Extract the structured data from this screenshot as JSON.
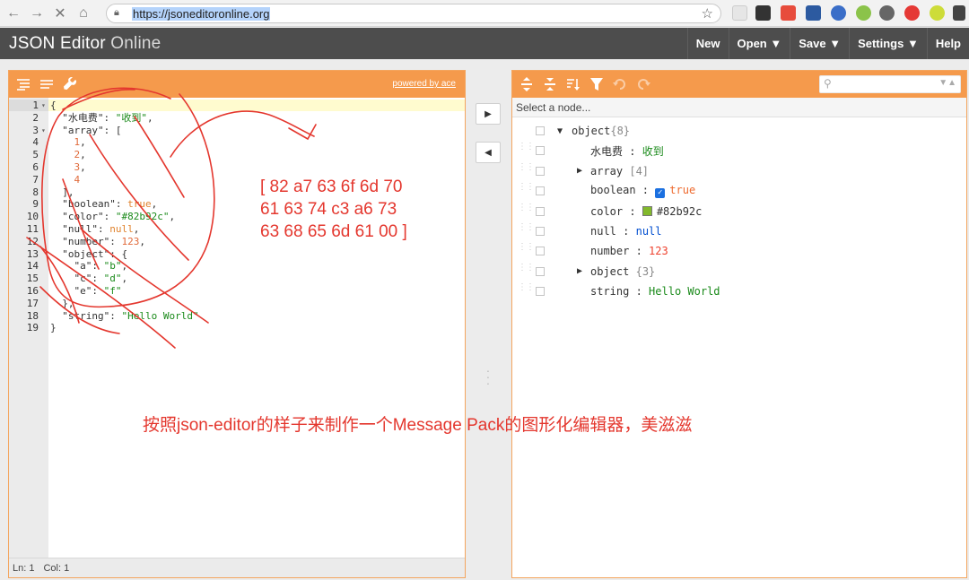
{
  "browser": {
    "url": "https://jsoneditoronline.org"
  },
  "app": {
    "title_bold": "JSON Editor",
    "title_light": "Online",
    "menus": [
      "New",
      "Open ▼",
      "Save ▼",
      "Settings ▼",
      "Help"
    ]
  },
  "code_editor": {
    "powered_by": "powered by ace",
    "lines": [
      {
        "n": "1",
        "fold": "▾",
        "parts": [
          [
            "k",
            "{"
          ]
        ]
      },
      {
        "n": "2",
        "fold": "",
        "parts": [
          [
            "k",
            "  \"水电费\": "
          ],
          [
            "s",
            "\"收到\""
          ],
          [
            "k",
            ","
          ]
        ]
      },
      {
        "n": "3",
        "fold": "▾",
        "parts": [
          [
            "k",
            "  \"array\": ["
          ]
        ]
      },
      {
        "n": "4",
        "fold": "",
        "parts": [
          [
            "k",
            "    "
          ],
          [
            "n",
            "1"
          ],
          [
            "k",
            ","
          ]
        ]
      },
      {
        "n": "5",
        "fold": "",
        "parts": [
          [
            "k",
            "    "
          ],
          [
            "n",
            "2"
          ],
          [
            "k",
            ","
          ]
        ]
      },
      {
        "n": "6",
        "fold": "",
        "parts": [
          [
            "k",
            "    "
          ],
          [
            "n",
            "3"
          ],
          [
            "k",
            ","
          ]
        ]
      },
      {
        "n": "7",
        "fold": "",
        "parts": [
          [
            "k",
            "    "
          ],
          [
            "n",
            "4"
          ]
        ]
      },
      {
        "n": "8",
        "fold": "",
        "parts": [
          [
            "k",
            "  ],"
          ]
        ]
      },
      {
        "n": "9",
        "fold": "",
        "parts": [
          [
            "k",
            "  \"boolean\": "
          ],
          [
            "b",
            "true"
          ],
          [
            "k",
            ","
          ]
        ]
      },
      {
        "n": "10",
        "fold": "",
        "parts": [
          [
            "k",
            "  \"color\": "
          ],
          [
            "s",
            "\"#82b92c\""
          ],
          [
            "k",
            ","
          ]
        ]
      },
      {
        "n": "11",
        "fold": "",
        "parts": [
          [
            "k",
            "  \"null\": "
          ],
          [
            "b",
            "null"
          ],
          [
            "k",
            ","
          ]
        ]
      },
      {
        "n": "12",
        "fold": "",
        "parts": [
          [
            "k",
            "  \"number\": "
          ],
          [
            "n",
            "123"
          ],
          [
            "k",
            ","
          ]
        ]
      },
      {
        "n": "13",
        "fold": "",
        "parts": [
          [
            "k",
            "  \"object\": {"
          ]
        ]
      },
      {
        "n": "14",
        "fold": "",
        "parts": [
          [
            "k",
            "    \"a\": "
          ],
          [
            "s",
            "\"b\""
          ],
          [
            "k",
            ","
          ]
        ]
      },
      {
        "n": "15",
        "fold": "",
        "parts": [
          [
            "k",
            "    \"c\": "
          ],
          [
            "s",
            "\"d\""
          ],
          [
            "k",
            ","
          ]
        ]
      },
      {
        "n": "16",
        "fold": "",
        "parts": [
          [
            "k",
            "    \"e\": "
          ],
          [
            "s",
            "\"f\""
          ]
        ]
      },
      {
        "n": "17",
        "fold": "",
        "parts": [
          [
            "k",
            "  },"
          ]
        ]
      },
      {
        "n": "18",
        "fold": "",
        "parts": [
          [
            "k",
            "  \"string\": "
          ],
          [
            "s",
            "\"Hello World\""
          ]
        ]
      },
      {
        "n": "19",
        "fold": "",
        "parts": [
          [
            "k",
            "}"
          ]
        ]
      }
    ],
    "status_ln": "Ln: 1",
    "status_col": "Col: 1"
  },
  "tree_editor": {
    "crumb": "Select a node...",
    "rows": [
      {
        "indent": 0,
        "expander": "▼",
        "key": "object",
        "sep": "",
        "val": "{8}",
        "type": "count",
        "drag": false
      },
      {
        "indent": 1,
        "expander": "",
        "key": "水电费",
        "sep": " : ",
        "val": "收到",
        "type": "str",
        "drag": true
      },
      {
        "indent": 1,
        "expander": "▶",
        "key": "array",
        "sep": " ",
        "val": "[4]",
        "type": "count",
        "drag": true
      },
      {
        "indent": 1,
        "expander": "",
        "key": "boolean",
        "sep": " : ",
        "val": "true",
        "type": "bool",
        "drag": true
      },
      {
        "indent": 1,
        "expander": "",
        "key": "color",
        "sep": " : ",
        "val": "#82b92c",
        "type": "color",
        "drag": true
      },
      {
        "indent": 1,
        "expander": "",
        "key": "null",
        "sep": " : ",
        "val": "null",
        "type": "null",
        "drag": true
      },
      {
        "indent": 1,
        "expander": "",
        "key": "number",
        "sep": " : ",
        "val": "123",
        "type": "num",
        "drag": true
      },
      {
        "indent": 1,
        "expander": "▶",
        "key": "object",
        "sep": " ",
        "val": "{3}",
        "type": "count",
        "drag": true
      },
      {
        "indent": 1,
        "expander": "",
        "key": "string",
        "sep": " : ",
        "val": "Hello World",
        "type": "str",
        "drag": true
      }
    ],
    "color_swatch": "#82b92c"
  },
  "annotation": {
    "hex_lines": [
      "[ 82 a7 63 6f 6d 70",
      "61 63 74 c3 a6 73",
      "63 68 65 6d 61 00 ]"
    ],
    "caption": "按照json-editor的样子来制作一个Message Pack的图形化编辑器，美滋滋"
  },
  "colors": {
    "accent": "#f59a4c",
    "menubar": "#4d4d4d",
    "annotation": "#e4372e"
  }
}
